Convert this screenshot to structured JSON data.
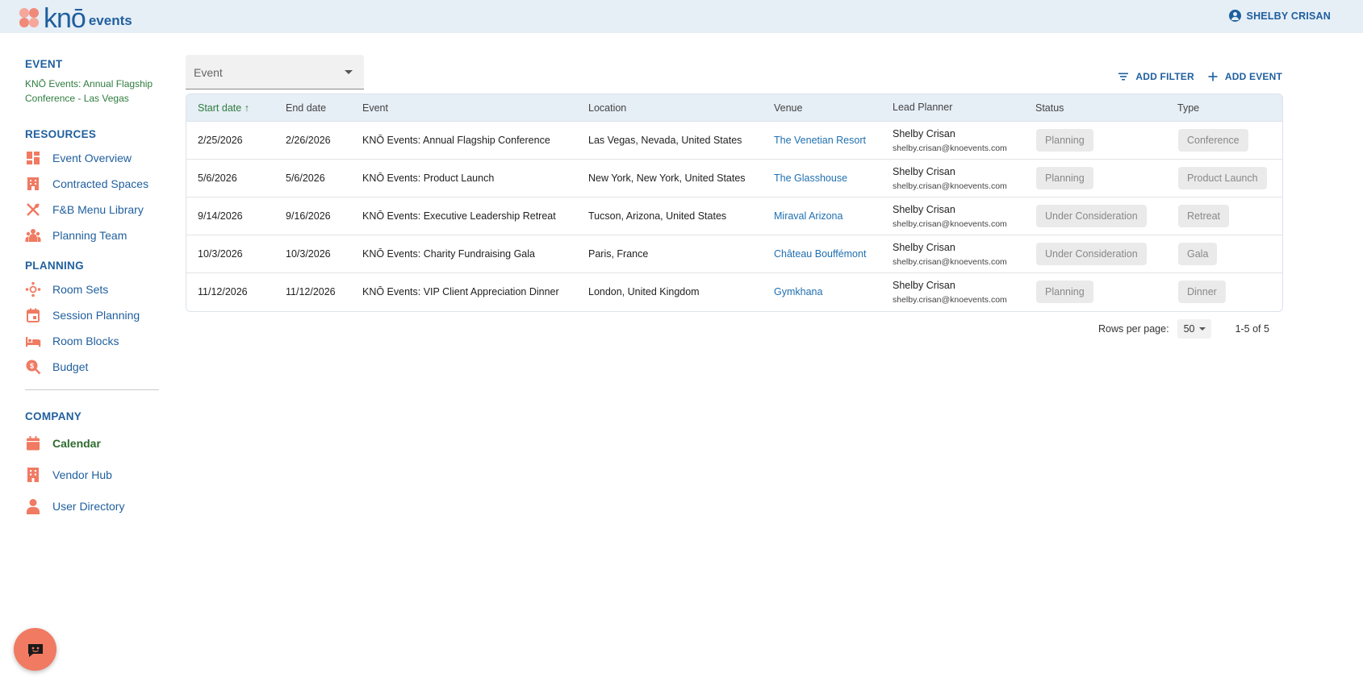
{
  "header": {
    "logo_text": "knō",
    "logo_sub": "events",
    "user_name": "SHELBY CRISAN"
  },
  "sidebar": {
    "event_title": "EVENT",
    "event_name": "KNŌ Events: Annual Flagship Conference - Las Vegas",
    "resources_title": "RESOURCES",
    "resources": [
      {
        "label": "Event Overview",
        "icon": "dashboard-icon"
      },
      {
        "label": "Contracted Spaces",
        "icon": "building-icon"
      },
      {
        "label": "F&B Menu Library",
        "icon": "utensils-icon"
      },
      {
        "label": "Planning Team",
        "icon": "team-icon"
      }
    ],
    "planning_title": "PLANNING",
    "planning": [
      {
        "label": "Room Sets",
        "icon": "room-sets-icon"
      },
      {
        "label": "Session Planning",
        "icon": "calendar-icon"
      },
      {
        "label": "Room Blocks",
        "icon": "bed-icon"
      },
      {
        "label": "Budget",
        "icon": "budget-icon"
      }
    ],
    "company_title": "COMPANY",
    "company": [
      {
        "label": "Calendar",
        "icon": "calendar-filled-icon",
        "active": true
      },
      {
        "label": "Vendor Hub",
        "icon": "vendor-icon"
      },
      {
        "label": "User Directory",
        "icon": "person-icon"
      }
    ]
  },
  "filter": {
    "select_label": "Event"
  },
  "actions": {
    "add_filter": "ADD FILTER",
    "add_event": "ADD EVENT"
  },
  "table": {
    "columns": [
      "Start date",
      "End date",
      "Event",
      "Location",
      "Venue",
      "Lead Planner",
      "Status",
      "Type"
    ],
    "rows": [
      {
        "start": "2/25/2026",
        "end": "2/26/2026",
        "event": "KNŌ Events: Annual Flagship Conference",
        "location": "Las Vegas, Nevada, United States",
        "venue": "The Venetian Resort",
        "planner": "Shelby Crisan",
        "email": "shelby.crisan@knoevents.com",
        "status": "Planning",
        "type": "Conference"
      },
      {
        "start": "5/6/2026",
        "end": "5/6/2026",
        "event": "KNŌ Events: Product Launch",
        "location": "New York, New York, United States",
        "venue": "The Glasshouse",
        "planner": "Shelby Crisan",
        "email": "shelby.crisan@knoevents.com",
        "status": "Planning",
        "type": "Product Launch"
      },
      {
        "start": "9/14/2026",
        "end": "9/16/2026",
        "event": "KNŌ Events: Executive Leadership Retreat",
        "location": "Tucson, Arizona, United States",
        "venue": "Miraval Arizona",
        "planner": "Shelby Crisan",
        "email": "shelby.crisan@knoevents.com",
        "status": "Under Consideration",
        "type": "Retreat"
      },
      {
        "start": "10/3/2026",
        "end": "10/3/2026",
        "event": "KNŌ Events: Charity Fundraising Gala",
        "location": "Paris, France",
        "venue": "Château Bouffémont",
        "planner": "Shelby Crisan",
        "email": "shelby.crisan@knoevents.com",
        "status": "Under Consideration",
        "type": "Gala"
      },
      {
        "start": "11/12/2026",
        "end": "11/12/2026",
        "event": "KNŌ Events: VIP Client Appreciation Dinner",
        "location": "London, United Kingdom",
        "venue": "Gymkhana",
        "planner": "Shelby Crisan",
        "email": "shelby.crisan@knoevents.com",
        "status": "Planning",
        "type": "Dinner"
      }
    ]
  },
  "pagination": {
    "rows_per_page_label": "Rows per page:",
    "rows_per_page": "50",
    "range": "1-5 of 5"
  },
  "colors": {
    "primary": "#1f5f9e",
    "accent": "#f07a62",
    "active": "#2f7d3e",
    "header_bg": "#e6eef6"
  }
}
